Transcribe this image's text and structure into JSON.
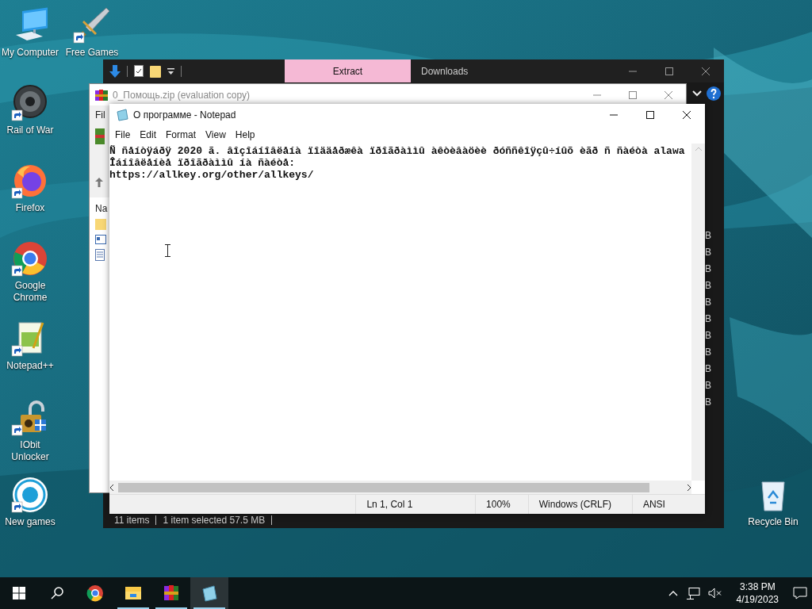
{
  "desktop_icons": [
    {
      "label": "My Computer",
      "kind": "computer"
    },
    {
      "label": "Free Games",
      "kind": "sword"
    },
    {
      "label": "Rail of War",
      "kind": "wheel"
    },
    {
      "label": "Firefox",
      "kind": "firefox"
    },
    {
      "label": "Google Chrome",
      "kind": "chrome"
    },
    {
      "label": "Notepad++",
      "kind": "notepadpp"
    },
    {
      "label": "IObit Unlocker",
      "kind": "padlock"
    },
    {
      "label": "New games",
      "kind": "ring"
    },
    {
      "label": "Recycle Bin",
      "kind": "recycle"
    }
  ],
  "explorer_window": {
    "tabs": [
      {
        "label": "Extract",
        "selected": true
      },
      {
        "label": "Downloads",
        "selected": false
      }
    ],
    "column_values": [
      "B",
      "B",
      "B",
      "B",
      "B",
      "B",
      "B",
      "B",
      "B",
      "B",
      "B"
    ],
    "status_bar": [
      "11 items",
      "1 item selected  57.5 MB"
    ]
  },
  "winrar_window": {
    "title": "0_Помощь.zip (evaluation copy)",
    "menu_item": "Fil",
    "column_header": "Na"
  },
  "notepad": {
    "title": "О программе - Notepad",
    "menu": [
      "File",
      "Edit",
      "Format",
      "View",
      "Help"
    ],
    "lines": [
      "Ñ ñåíòÿáðÿ 2020 ã. âîçîáíîâëåíà ïîääåðæêà ïðîãðàììû àêòèâàöèè ðóññêîÿçû÷íûõ èãð ñ ñàéòà alawa",
      "Îáíîâëåíèå ïðîãðàììû íà ñàéòå:",
      "https://allkey.org/other/allkeys/"
    ],
    "status_bar": [
      "Ln 1, Col 1",
      "100%",
      "Windows (CRLF)",
      "ANSI"
    ]
  },
  "taskbar": {
    "apps": [
      {
        "kind": "chrome",
        "running": false,
        "selected": false
      },
      {
        "kind": "folder",
        "running": true,
        "selected": false
      },
      {
        "kind": "winrar",
        "running": true,
        "selected": false
      },
      {
        "kind": "notepad",
        "running": true,
        "selected": true
      }
    ],
    "time": "3:38 PM",
    "date": "4/19/2023"
  }
}
